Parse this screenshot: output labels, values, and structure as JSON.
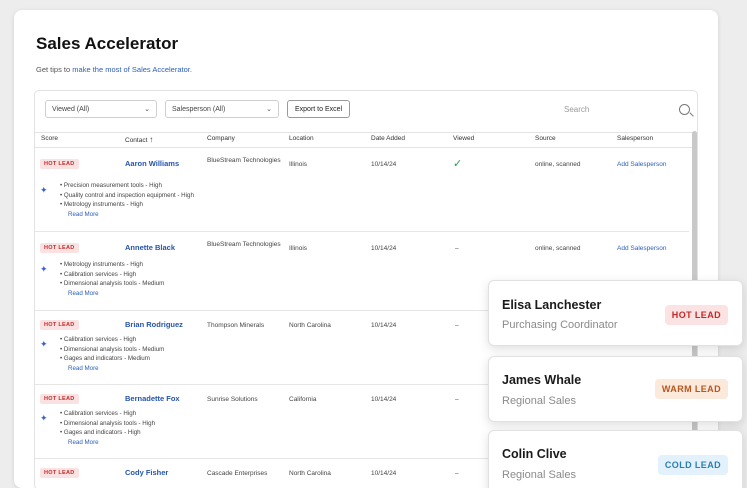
{
  "page_title": "Sales Accelerator",
  "tips": {
    "prefix": "Get tips to ",
    "link": "make the most of Sales Accelerator",
    "suffix": "."
  },
  "filters": {
    "viewed": "Viewed (All)",
    "salesperson": "Salesperson (All)",
    "export": "Export to Excel"
  },
  "search": {
    "placeholder": "Search"
  },
  "columns": [
    "Score",
    "Contact",
    "Company",
    "Location",
    "Date Added",
    "Viewed",
    "Source",
    "Salesperson"
  ],
  "sort_arrow": "↑",
  "rows": [
    {
      "score": "HOT LEAD",
      "contact": "Aaron Williams",
      "company": "BlueStream Technologies",
      "location": "Illinois",
      "date": "10/14/24",
      "viewed": "✓",
      "source": "online, scanned",
      "salesperson": "Add Salesperson",
      "interests": [
        "Precision measurement tools - High",
        "Quality control and inspection equipment - High",
        "Metrology instruments - High"
      ],
      "more": "Read More"
    },
    {
      "score": "HOT LEAD",
      "contact": "Annette Black",
      "company": "BlueStream Technologies",
      "location": "Illinois",
      "date": "10/14/24",
      "viewed": "–",
      "source": "online, scanned",
      "salesperson": "Add Salesperson",
      "interests": [
        "Metrology instruments - High",
        "Calibration services - High",
        "Dimensional analysis tools - Medium"
      ],
      "more": "Read More"
    },
    {
      "score": "HOT LEAD",
      "contact": "Brian Rodriguez",
      "company": "Thompson Minerals",
      "location": "North Carolina",
      "date": "10/14/24",
      "viewed": "–",
      "source": "",
      "salesperson": "",
      "interests": [
        "Calibration services - High",
        "Dimensional analysis tools - Medium",
        "Gages and indicators - Medium"
      ],
      "more": "Read More"
    },
    {
      "score": "HOT LEAD",
      "contact": "Bernadette Fox",
      "company": "Sunrise Solutions",
      "location": "California",
      "date": "10/14/24",
      "viewed": "–",
      "source": "",
      "salesperson": "",
      "interests": [
        "Calibration services - High",
        "Dimensional analysis tools - High",
        "Gages and indicators - High"
      ],
      "more": "Read More"
    },
    {
      "score": "HOT LEAD",
      "contact": "Cody Fisher",
      "company": "Cascade Enterprises",
      "location": "North Carolina",
      "date": "10/14/24",
      "viewed": "–",
      "source": "",
      "salesperson": "",
      "interests": [],
      "more": ""
    }
  ],
  "lead_cards": [
    {
      "name": "Elisa Lanchester",
      "role": "Purchasing Coordinator",
      "badge": "HOT LEAD",
      "badge_bg": "#fbe3e3",
      "badge_fg": "#c62828"
    },
    {
      "name": "James Whale",
      "role": "Regional Sales",
      "badge": "WARM LEAD",
      "badge_bg": "#fbe9dc",
      "badge_fg": "#b8561f"
    },
    {
      "name": "Colin Clive",
      "role": "Regional Sales",
      "badge": "COLD LEAD",
      "badge_bg": "#e2f1fb",
      "badge_fg": "#2a7fb4"
    }
  ],
  "icons": {
    "spark": "sparkle-icon",
    "search": "search-icon",
    "check": "check-icon"
  }
}
